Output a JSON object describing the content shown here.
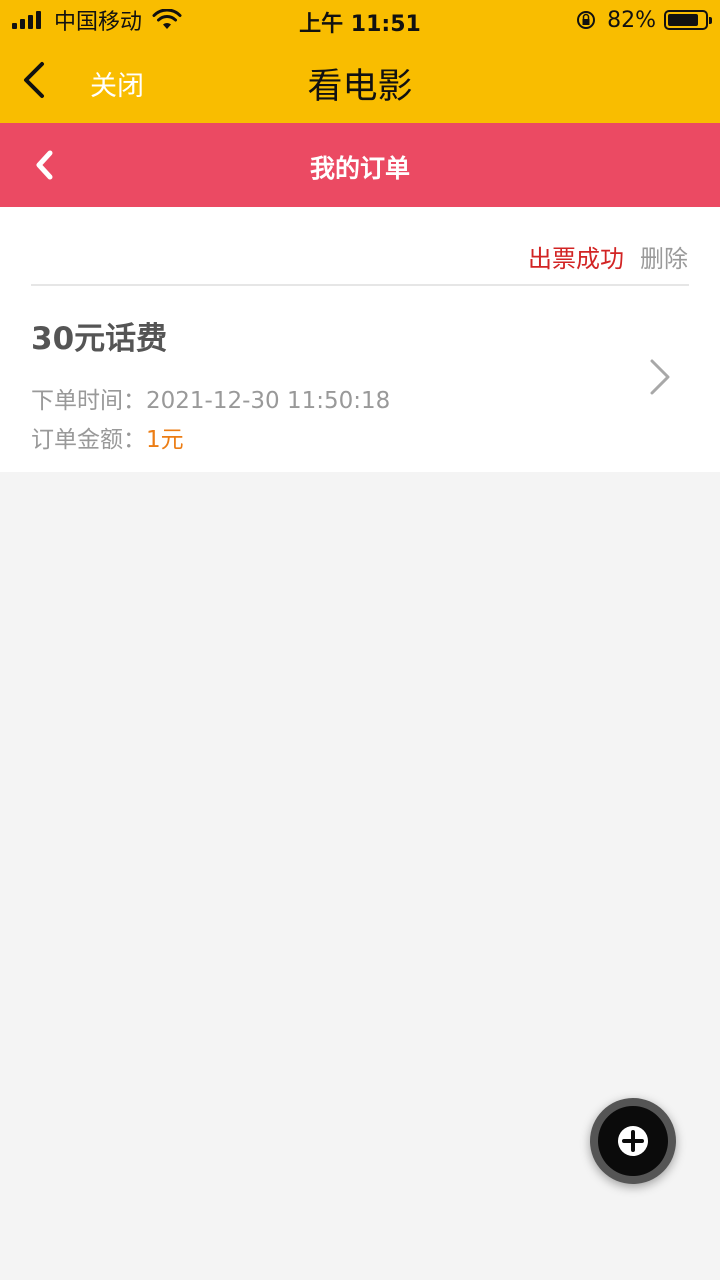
{
  "status_bar": {
    "carrier": "中国移动",
    "time": "上午 11:51",
    "battery_percent": "82%",
    "battery_level": 0.82,
    "icons": [
      "signal-icon",
      "wifi-icon",
      "orientation-lock-icon",
      "battery-icon"
    ]
  },
  "nav_bar": {
    "back_icon": "chevron-left-icon",
    "close_label": "关闭",
    "title": "看电影"
  },
  "page_header": {
    "back_icon": "chevron-left-icon",
    "title": "我的订单"
  },
  "order": {
    "status": "出票成功",
    "delete_label": "删除",
    "title": "30元话费",
    "time_label": "下单时间：",
    "time_value": "2021-12-30 11:50:18",
    "amount_label": "订单金额：",
    "amount_value": "1元",
    "detail_icon": "chevron-right-icon"
  },
  "fab": {
    "icon": "plus-icon"
  },
  "colors": {
    "top_bar": "#f9bd00",
    "header": "#eb4a63",
    "status_success": "#d22424",
    "amount": "#ec7d14",
    "background": "#f4f4f4"
  }
}
